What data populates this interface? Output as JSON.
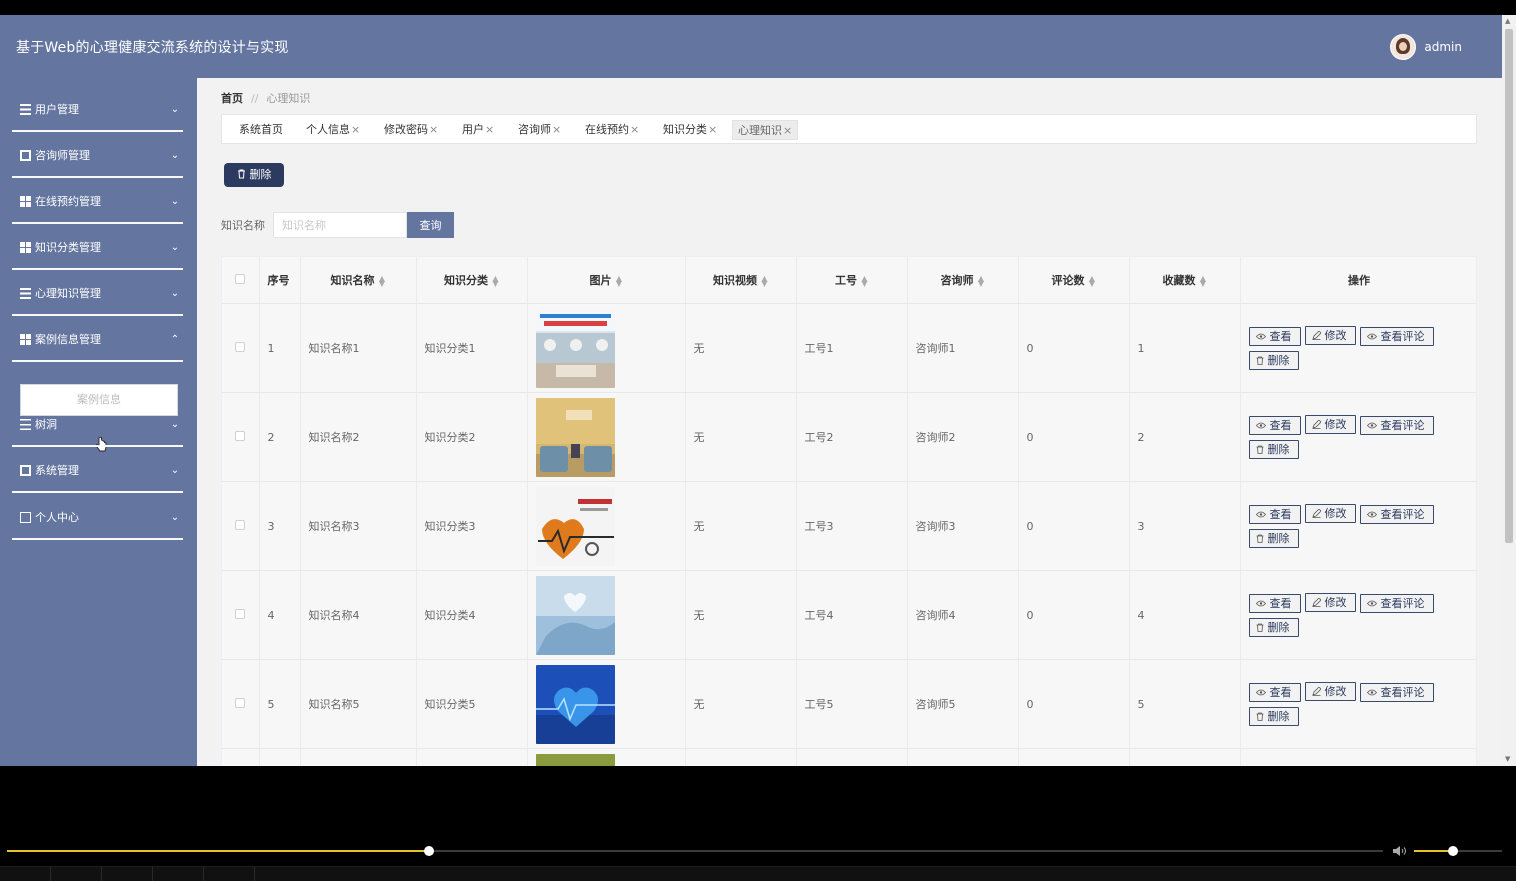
{
  "header": {
    "title": "基于Web的心理健康交流系统的设计与实现",
    "username": "admin"
  },
  "sidebar": {
    "items": [
      {
        "label": "用户管理",
        "icon": "bars-icon",
        "chevron": "⌄"
      },
      {
        "label": "咨询师管理",
        "icon": "doc-icon",
        "chevron": "⌄"
      },
      {
        "label": "在线预约管理",
        "icon": "grid-icon",
        "chevron": "⌄"
      },
      {
        "label": "知识分类管理",
        "icon": "grid-icon",
        "chevron": "⌄"
      },
      {
        "label": "心理知识管理",
        "icon": "bars-icon",
        "chevron": "⌄"
      },
      {
        "label": "案例信息管理",
        "icon": "grid-icon",
        "chevron": "⌃"
      },
      {
        "label": "树洞",
        "icon": "sliders-icon",
        "chevron": "⌄"
      },
      {
        "label": "系统管理",
        "icon": "monitor-icon",
        "chevron": "⌄"
      },
      {
        "label": "个人中心",
        "icon": "card-icon",
        "chevron": "⌄"
      }
    ],
    "submenu_item": "案例信息"
  },
  "breadcrumb": {
    "home": "首页",
    "sep": "//",
    "current": "心理知识"
  },
  "tabs": [
    {
      "label": "系统首页",
      "close": ""
    },
    {
      "label": "个人信息",
      "close": "×"
    },
    {
      "label": "修改密码",
      "close": "×"
    },
    {
      "label": "用户",
      "close": "×"
    },
    {
      "label": "咨询师",
      "close": "×"
    },
    {
      "label": "在线预约",
      "close": "×"
    },
    {
      "label": "知识分类",
      "close": "×"
    },
    {
      "label": "心理知识",
      "close": "×"
    }
  ],
  "toolbar": {
    "delete_label": "删除"
  },
  "search": {
    "label": "知识名称",
    "placeholder": "知识名称",
    "button": "查询"
  },
  "table": {
    "headers": [
      "序号",
      "知识名称",
      "知识分类",
      "图片",
      "知识视频",
      "工号",
      "咨询师",
      "评论数",
      "收藏数",
      "操作"
    ],
    "rows": [
      {
        "index": "1",
        "name": "知识名称1",
        "category": "知识分类1",
        "video": "无",
        "staff_no": "工号1",
        "counselor": "咨询师1",
        "comments": "0",
        "favorites": "1"
      },
      {
        "index": "2",
        "name": "知识名称2",
        "category": "知识分类2",
        "video": "无",
        "staff_no": "工号2",
        "counselor": "咨询师2",
        "comments": "0",
        "favorites": "2"
      },
      {
        "index": "3",
        "name": "知识名称3",
        "category": "知识分类3",
        "video": "无",
        "staff_no": "工号3",
        "counselor": "咨询师3",
        "comments": "0",
        "favorites": "3"
      },
      {
        "index": "4",
        "name": "知识名称4",
        "category": "知识分类4",
        "video": "无",
        "staff_no": "工号4",
        "counselor": "咨询师4",
        "comments": "0",
        "favorites": "4"
      },
      {
        "index": "5",
        "name": "知识名称5",
        "category": "知识分类5",
        "video": "无",
        "staff_no": "工号5",
        "counselor": "咨询师5",
        "comments": "0",
        "favorites": "5"
      }
    ],
    "actions": {
      "view": "查看",
      "edit": "修改",
      "view_comments": "查看评论",
      "delete": "删除"
    }
  },
  "player": {
    "progress": 0.307,
    "volume": 0.44,
    "accent": "#e7c22d"
  },
  "colors": {
    "sidebar": "#64769f",
    "primary_dark": "#2b3a5e"
  }
}
